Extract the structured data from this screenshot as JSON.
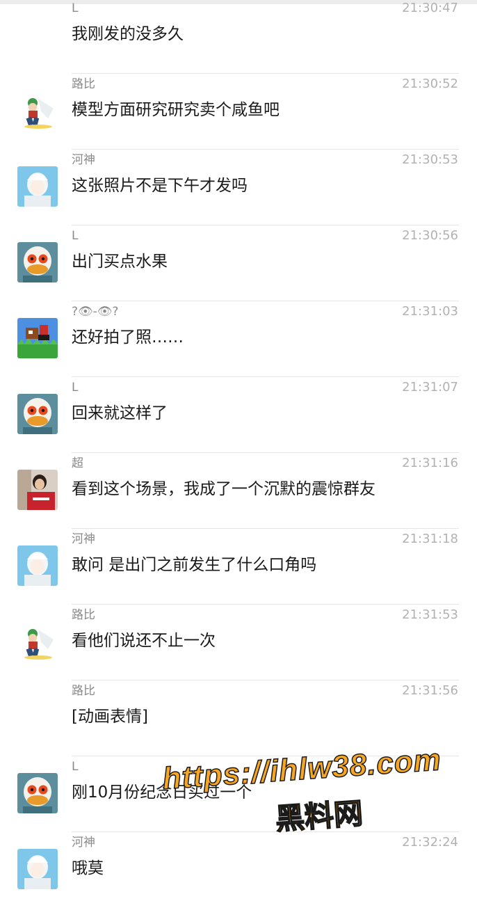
{
  "messages": [
    {
      "name": "L",
      "time": "21:30:47",
      "text": "我刚发的没多久",
      "avatar": "none"
    },
    {
      "name": "路比",
      "time": "21:30:52",
      "text": "模型方面研究研究卖个咸鱼吧",
      "avatar": "luffy-avatar"
    },
    {
      "name": "河神",
      "time": "21:30:53",
      "text": "这张照片不是下午才发吗",
      "avatar": "anime-avatar"
    },
    {
      "name": "L",
      "time": "21:30:56",
      "text": "出门买点水果",
      "avatar": "duck-avatar"
    },
    {
      "name": "?👁-👁?",
      "time": "21:31:03",
      "text": "还好拍了照……",
      "avatar": "game-avatar"
    },
    {
      "name": "L",
      "time": "21:31:07",
      "text": "回来就这样了",
      "avatar": "duck-avatar"
    },
    {
      "name": "超",
      "time": "21:31:16",
      "text": "看到这个场景，我成了一个沉默的震惊群友",
      "avatar": "photo-avatar"
    },
    {
      "name": "河神",
      "time": "21:31:18",
      "text": "敢问  是出门之前发生了什么口角吗",
      "avatar": "anime-avatar"
    },
    {
      "name": "路比",
      "time": "21:31:53",
      "text": "看他们说还不止一次",
      "avatar": "luffy-avatar"
    },
    {
      "name": "路比",
      "time": "21:31:56",
      "text": "[动画表情]",
      "avatar": "none"
    },
    {
      "name": "L",
      "time": "",
      "text": "刚10月份纪念日买过一个",
      "avatar": "duck-avatar"
    },
    {
      "name": "河神",
      "time": "21:32:24",
      "text": "哦莫",
      "avatar": "anime-avatar"
    }
  ],
  "watermark": {
    "line1": "https://ihlw38.com",
    "line2": "黑料网"
  },
  "colors": {
    "name": "#8a8a8a",
    "time": "#b2b2b2",
    "text": "#1a1a1a",
    "separator": "#e6e6e6",
    "watermark": "#f5a623"
  }
}
